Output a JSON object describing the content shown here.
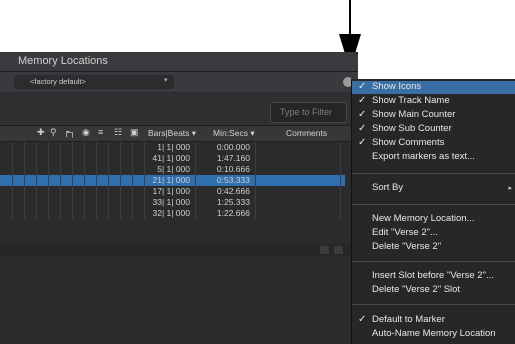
{
  "window": {
    "title": "Memory Locations"
  },
  "preset": {
    "label": "<factory default>",
    "dropdown_icon": "chevron-down-icon"
  },
  "filter": {
    "placeholder": "Type to Filter"
  },
  "columns": {
    "bars_beats": "Bars|Beats ▾",
    "min_secs": "Min:Secs ▾",
    "comments": "Comments"
  },
  "header_icons": [
    "zoom-icon",
    "magnify-icon",
    "pre-post-roll-icon",
    "eye-icon",
    "track-height-icon",
    "group-icon",
    "window-config-icon"
  ],
  "rows": [
    {
      "bars": "1| 1| 000",
      "time": "0:00.000",
      "selected": false
    },
    {
      "bars": "41| 1| 000",
      "time": "1:47.160",
      "selected": false
    },
    {
      "bars": "5| 1| 000",
      "time": "0:10.666",
      "selected": false
    },
    {
      "bars": "21| 1| 000",
      "time": "0:53.333",
      "selected": true
    },
    {
      "bars": "17| 1| 000",
      "time": "0:42.666",
      "selected": false
    },
    {
      "bars": "33| 1| 000",
      "time": "1:25.333",
      "selected": false
    },
    {
      "bars": "32| 1| 000",
      "time": "1:22.666",
      "selected": false
    }
  ],
  "menu": {
    "items": [
      {
        "label": "Show Icons",
        "checked": true,
        "highlighted": true
      },
      {
        "label": "Show Track Name",
        "checked": true
      },
      {
        "label": "Show Main Counter",
        "checked": true
      },
      {
        "label": "Show Sub Counter",
        "checked": true
      },
      {
        "label": "Show Comments",
        "checked": true
      },
      {
        "label": "Export markers as text...",
        "checked": false
      },
      {
        "label": "Sort By",
        "checked": false,
        "submenu": true
      },
      {
        "label": "New Memory Location...",
        "checked": false
      },
      {
        "label": "Edit \"Verse 2\"...",
        "checked": false
      },
      {
        "label": "Delete \"Verse 2\"",
        "checked": false
      },
      {
        "label": "Insert Slot before \"Verse 2\"...",
        "checked": false
      },
      {
        "label": "Delete \"Verse 2\" Slot",
        "checked": false
      },
      {
        "label": "Default to Marker",
        "checked": true
      },
      {
        "label": "Auto-Name Memory Location",
        "checked": false
      }
    ],
    "check_glyph": "✓",
    "submenu_glyph": "▸"
  },
  "colors": {
    "selection": "#2f6fae",
    "menu_highlight": "#3a6fa6",
    "background": "#2b2b2e"
  }
}
